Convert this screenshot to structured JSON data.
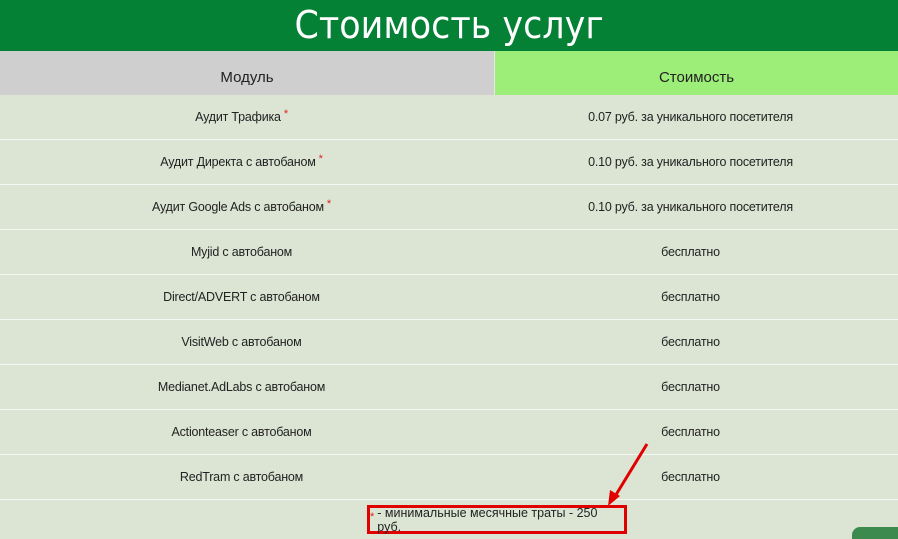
{
  "header": {
    "title": "Стоимость услуг"
  },
  "table": {
    "columns": [
      "Модуль",
      "Стоимость"
    ],
    "rows": [
      {
        "module": "Аудит Трафика",
        "star": "*",
        "price": "0.07 руб. за уникального посетителя"
      },
      {
        "module": "Аудит Директа с автобаном",
        "star": "*",
        "price": "0.10 руб. за уникального посетителя"
      },
      {
        "module": "Аудит Google Ads с автобаном",
        "star": "*",
        "price": "0.10 руб. за уникального посетителя"
      },
      {
        "module": "Myjid с автобаном",
        "star": "",
        "price": "бесплатно"
      },
      {
        "module": "Direct/ADVERT с автобаном",
        "star": "",
        "price": "бесплатно"
      },
      {
        "module": "VisitWeb с автобаном",
        "star": "",
        "price": "бесплатно"
      },
      {
        "module": "Medianet.AdLabs с автобаном",
        "star": "",
        "price": "бесплатно"
      },
      {
        "module": "Actionteaser с автобаном",
        "star": "",
        "price": "бесплатно"
      },
      {
        "module": "RedTram с автобаном",
        "star": "",
        "price": "бесплатно"
      }
    ]
  },
  "footnote": {
    "star": "*",
    "text": "- минимальные месячные траты - 250 руб."
  },
  "colors": {
    "title_bg": "#058136",
    "module_header_bg": "#cfcfcf",
    "price_header_bg": "#9ded79",
    "body_bg": "#dce5d4",
    "highlight": "#e00000"
  }
}
